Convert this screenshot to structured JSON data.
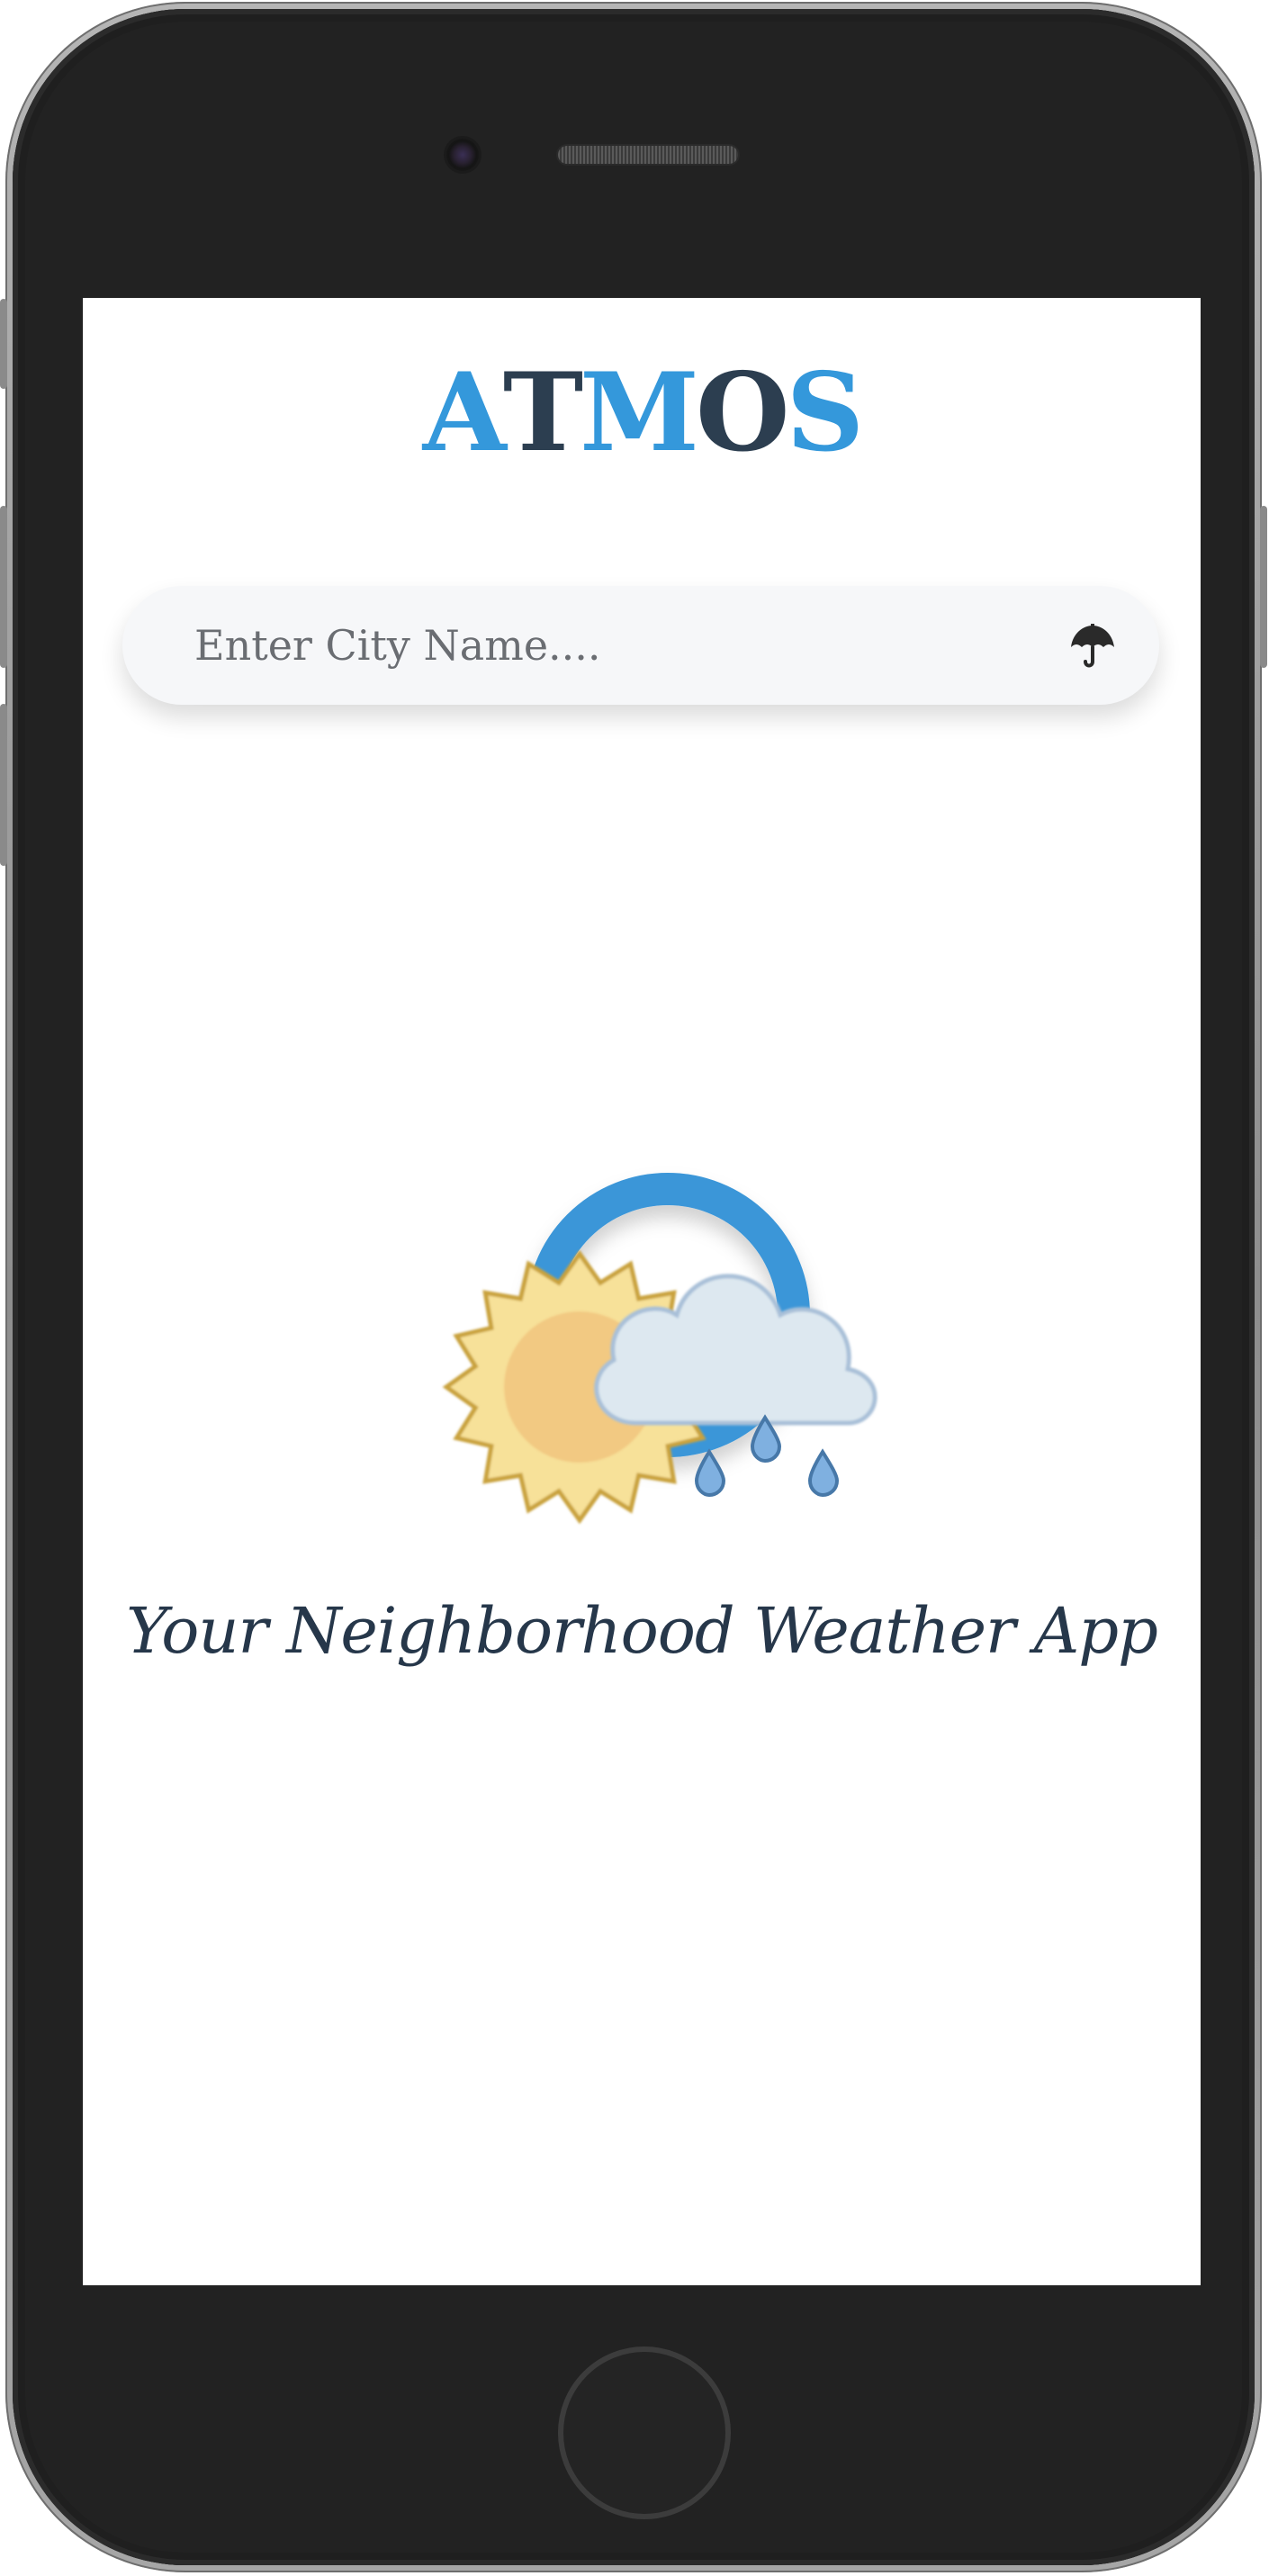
{
  "app": {
    "logo_letters": [
      {
        "char": "A",
        "color": "#3498db"
      },
      {
        "char": "T",
        "color": "#2c3e50"
      },
      {
        "char": "M",
        "color": "#3498db"
      },
      {
        "char": "O",
        "color": "#2c3e50"
      },
      {
        "char": "S",
        "color": "#3498db"
      }
    ]
  },
  "search": {
    "placeholder": "Enter City Name....",
    "value": "",
    "submit_icon": "umbrella-icon"
  },
  "hero": {
    "icon": "partly-sunny-rain-icon"
  },
  "tagline": "Your Neighborhood Weather App",
  "colors": {
    "accent": "#3498db",
    "dark": "#2c3e50",
    "device_body": "#222222"
  }
}
